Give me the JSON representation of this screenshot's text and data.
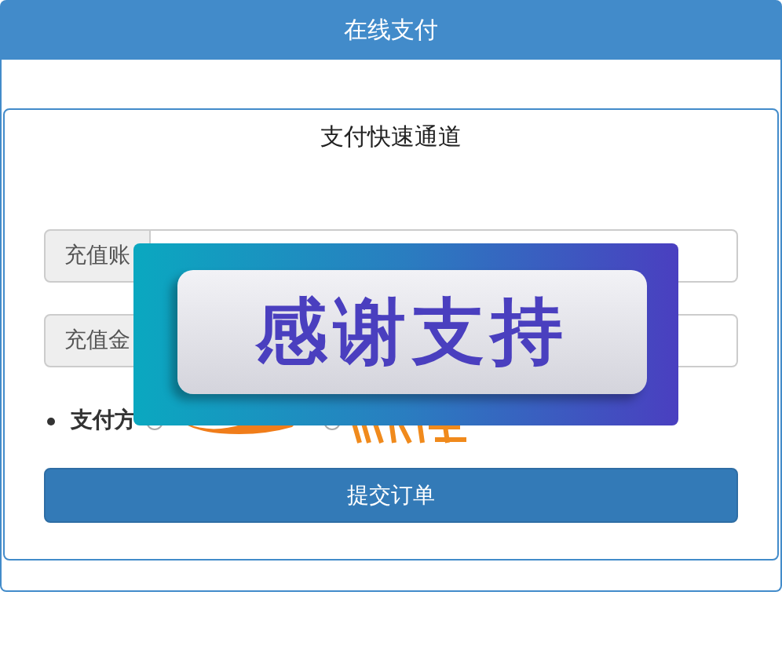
{
  "header": {
    "title": "在线支付"
  },
  "panel": {
    "title": "支付快速通道"
  },
  "fields": [
    {
      "label": "充值账"
    },
    {
      "label": "充值金"
    }
  ],
  "payment": {
    "label": "支付方",
    "options": [
      {
        "kind": "alipay",
        "selected": false
      },
      {
        "kind": "tenpay",
        "selected": false
      }
    ]
  },
  "submit": {
    "label": "提交订单"
  },
  "overlay": {
    "text": "感谢支持"
  }
}
